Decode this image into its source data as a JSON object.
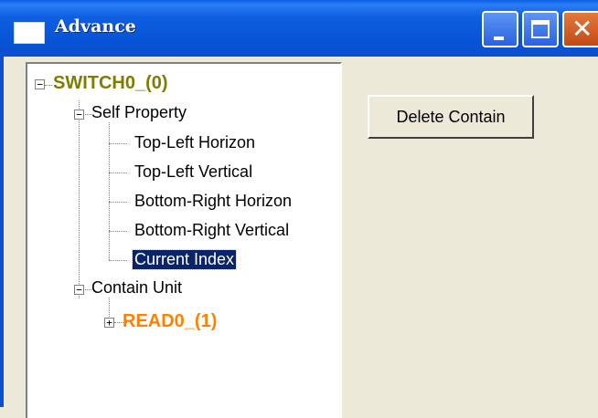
{
  "window": {
    "title": "Advance"
  },
  "tree": {
    "root": {
      "label": "SWITCH0_(0)",
      "expander": "−"
    },
    "self_property": {
      "label": "Self Property",
      "expander": "−"
    },
    "items": [
      "Top-Left Horizon",
      "Top-Left Vertical",
      "Bottom-Right Horizon",
      "Bottom-Right Vertical",
      "Current Index"
    ],
    "contain_unit": {
      "label": "Contain Unit",
      "expander": "−"
    },
    "read_unit": {
      "label": "READ0_(1)",
      "expander": "+"
    }
  },
  "buttons": {
    "delete_contain": "Delete Contain"
  },
  "colors": {
    "titlebar": "#0a54d6",
    "root_text": "#7d7d00",
    "unit_text": "#ff8000",
    "selection": "#0a246a"
  }
}
